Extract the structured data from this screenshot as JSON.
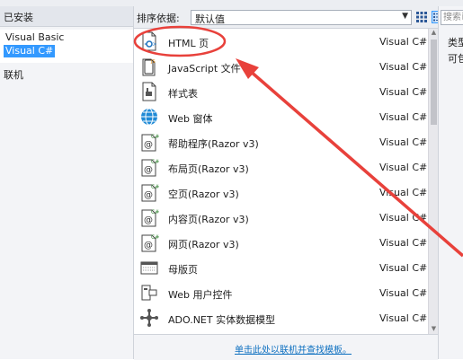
{
  "left_panel": {
    "installed_label": "已安装",
    "tree": [
      "Visual Basic",
      "Visual C#"
    ],
    "selected_index": 1,
    "online_label": "联机"
  },
  "toolbar": {
    "sort_label": "排序依据:",
    "sort_value": "默认值",
    "view_grid_icon": "small-icons-view-icon",
    "view_list_icon": "list-view-icon"
  },
  "items": [
    {
      "name": "HTML 页",
      "lang": "Visual C#",
      "icon": "html-page-icon"
    },
    {
      "name": "JavaScript 文件",
      "lang": "Visual C#",
      "icon": "javascript-file-icon"
    },
    {
      "name": "样式表",
      "lang": "Visual C#",
      "icon": "stylesheet-icon"
    },
    {
      "name": "Web 窗体",
      "lang": "Visual C#",
      "icon": "web-form-icon"
    },
    {
      "name": "帮助程序(Razor v3)",
      "lang": "Visual C#",
      "icon": "razor-helper-icon"
    },
    {
      "name": "布局页(Razor v3)",
      "lang": "Visual C#",
      "icon": "razor-layout-icon"
    },
    {
      "name": "空页(Razor v3)",
      "lang": "Visual C#",
      "icon": "razor-empty-page-icon"
    },
    {
      "name": "内容页(Razor v3)",
      "lang": "Visual C#",
      "icon": "razor-content-page-icon"
    },
    {
      "name": "网页(Razor v3)",
      "lang": "Visual C#",
      "icon": "razor-web-page-icon"
    },
    {
      "name": "母版页",
      "lang": "Visual C#",
      "icon": "master-page-icon"
    },
    {
      "name": "Web 用户控件",
      "lang": "Visual C#",
      "icon": "web-user-control-icon"
    },
    {
      "name": "ADO.NET 实体数据模型",
      "lang": "Visual C#",
      "icon": "ado-net-model-icon"
    }
  ],
  "bottom_link": "单击此处以联机并查找模板。",
  "right_panel": {
    "search_placeholder": "搜索已",
    "type_label": "类型",
    "desc_text": "可包"
  },
  "colors": {
    "selection": "#3399ff",
    "annotation": "#e8413b",
    "link": "#0e70c0"
  }
}
